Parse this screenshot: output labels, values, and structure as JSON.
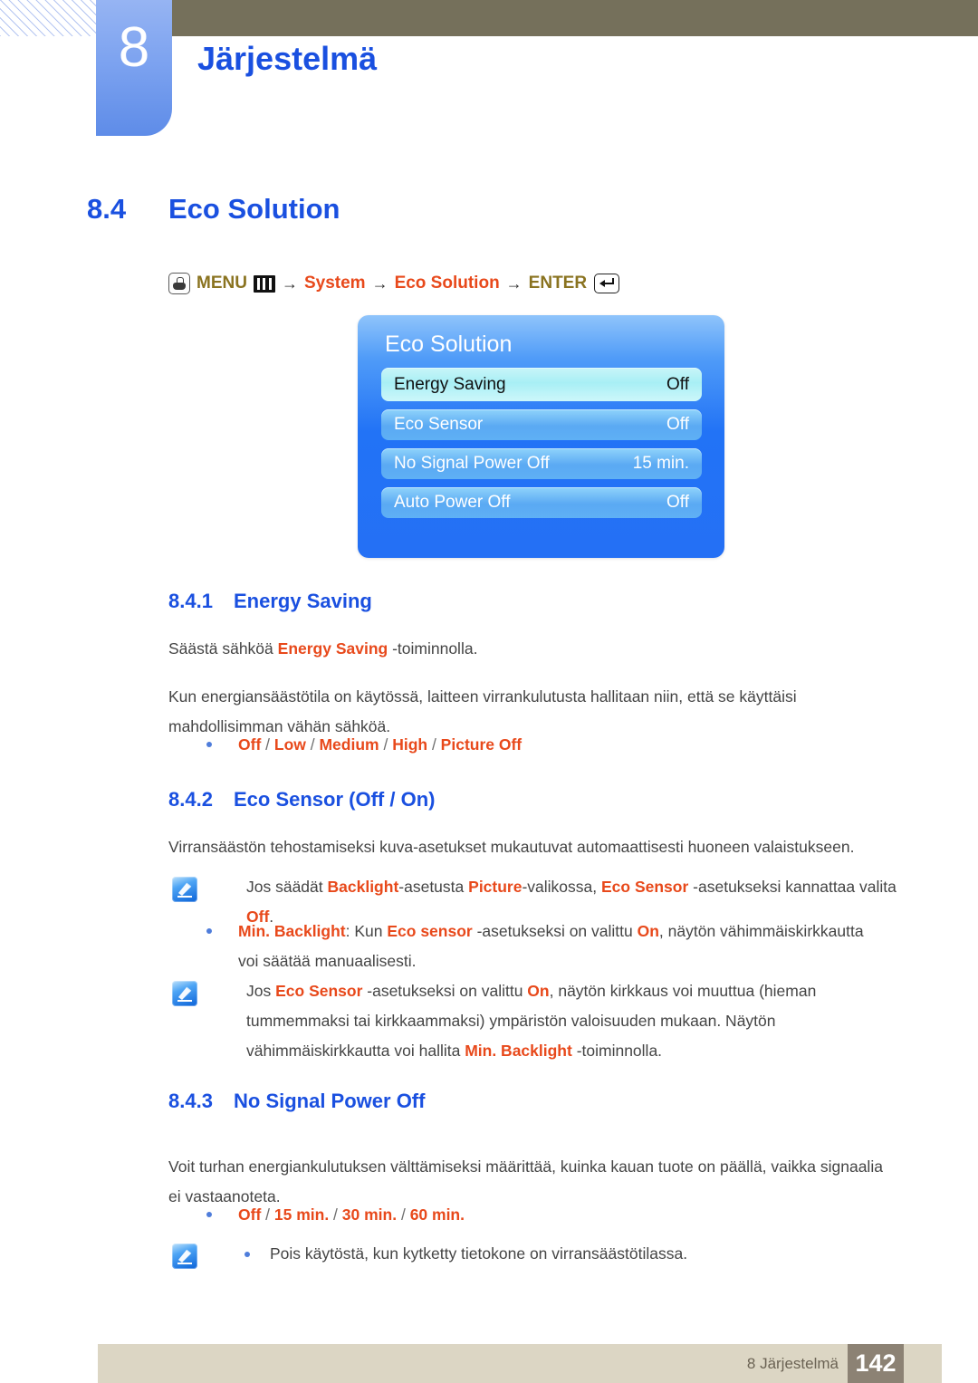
{
  "header": {
    "chapter_number": "8",
    "chapter_title": "Järjestelmä"
  },
  "section": {
    "number": "8.4",
    "title": "Eco Solution"
  },
  "menu_path": {
    "hand_icon": "hand-pointer-icon",
    "menu_label": "MENU",
    "grid_icon": "menu-grid-icon",
    "arrow1": "→",
    "item1": "System",
    "arrow2": "→",
    "item2": "Eco Solution",
    "arrow3": "→",
    "enter_label": "ENTER",
    "enter_icon": "enter-key-icon"
  },
  "osd": {
    "title": "Eco Solution",
    "rows": [
      {
        "label": "Energy Saving",
        "value": "Off",
        "selected": true
      },
      {
        "label": "Eco Sensor",
        "value": "Off",
        "selected": false
      },
      {
        "label": "No Signal Power Off",
        "value": "15 min.",
        "selected": false
      },
      {
        "label": "Auto Power Off",
        "value": "Off",
        "selected": false
      }
    ]
  },
  "sub1": {
    "number": "8.4.1",
    "title": "Energy Saving",
    "p1_a": "Säästä sähköä ",
    "p1_b": "Energy Saving",
    "p1_c": " -toiminnolla.",
    "p2": "Kun energiansäästötila on käytössä, laitteen virrankulutusta hallitaan niin, että se käyttäisi mahdollisimman vähän sähköä.",
    "bullet": {
      "o1": "Off",
      "sep1": " / ",
      "o2": "Low",
      "sep2": " / ",
      "o3": "Medium",
      "sep3": " / ",
      "o4": "High",
      "sep4": " / ",
      "o5": "Picture Off"
    }
  },
  "sub2": {
    "number": "8.4.2",
    "title": "Eco Sensor (Off / On)",
    "p1": "Virransäästön tehostamiseksi kuva-asetukset mukautuvat automaattisesti huoneen valaistukseen.",
    "note1": {
      "a": "Jos säädät ",
      "b": "Backlight",
      "c": "-asetusta ",
      "d": "Picture",
      "e": "-valikossa, ",
      "f": "Eco Sensor",
      "g": " -asetukseksi kannattaa valita ",
      "h": "Off",
      "i": "."
    },
    "bullet2": {
      "a": "Min. Backlight",
      "b": ": Kun ",
      "c": "Eco sensor",
      "d": " -asetukseksi on valittu ",
      "e": "On",
      "f": ", näytön vähimmäiskirkkautta voi säätää manuaalisesti."
    },
    "note2": {
      "a": "Jos ",
      "b": "Eco Sensor",
      "c": " -asetukseksi on valittu ",
      "d": "On",
      "e": ", näytön kirkkaus voi muuttua (hieman tummemmaksi tai kirkkaammaksi) ympäristön valoisuuden mukaan. Näytön vähimmäiskirkkautta voi hallita ",
      "f": "Min. Backlight",
      "g": " -toiminnolla."
    }
  },
  "sub3": {
    "number": "8.4.3",
    "title": "No Signal Power Off",
    "p1": "Voit turhan energiankulutuksen välttämiseksi määrittää, kuinka kauan tuote on päällä, vaikka signaalia ei vastaanoteta.",
    "bullet": {
      "o1": "Off",
      "sep1": " / ",
      "o2": "15 min.",
      "sep2": " / ",
      "o3": "30 min.",
      "sep3": " / ",
      "o4": "60 min."
    },
    "note": "Pois käytöstä, kun kytketty tietokone on virransäästötilassa."
  },
  "footer": {
    "label": "8 Järjestelmä",
    "page": "142"
  },
  "colors": {
    "heading_blue": "#1a50e0",
    "highlight_red": "#e8491b",
    "menu_olive": "#8a7320",
    "olive_bar": "#75705b",
    "footer_bar": "#dcd6c4",
    "footer_page_block": "#8c8274"
  }
}
